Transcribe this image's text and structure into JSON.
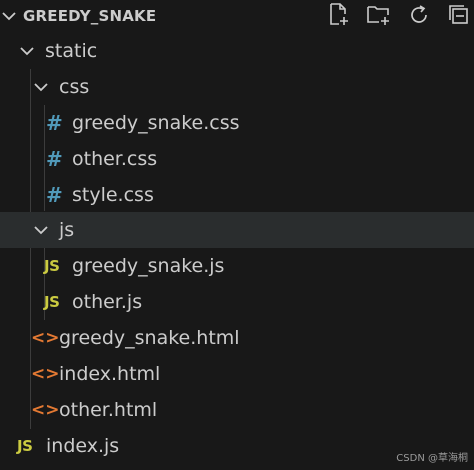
{
  "explorer": {
    "title": "GREEDY_SNAKE",
    "actions": [
      {
        "name": "new-file-icon"
      },
      {
        "name": "new-folder-icon"
      },
      {
        "name": "refresh-icon"
      },
      {
        "name": "collapse-all-icon"
      }
    ]
  },
  "tree": {
    "static": "static",
    "css": "css",
    "css_greedy": "greedy_snake.css",
    "css_other": "other.css",
    "css_style": "style.css",
    "js": "js",
    "js_greedy": "greedy_snake.js",
    "js_other": "other.js",
    "html_greedy": "greedy_snake.html",
    "html_index": "index.html",
    "html_other": "other.html",
    "root_index_js": "index.js"
  },
  "icons": {
    "css_glyph": "#",
    "js_glyph": "JS",
    "html_glyph": "<>"
  },
  "watermark": "CSDN @草海桐",
  "colors": {
    "background": "#181818",
    "selected_row": "#2a2d2e",
    "css_icon": "#519aba",
    "js_icon": "#cbcb41",
    "html_icon": "#e37933",
    "text": "#cccccc"
  }
}
